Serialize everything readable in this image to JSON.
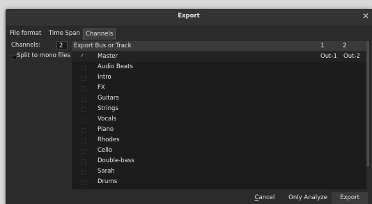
{
  "window": {
    "title": "Export"
  },
  "tabs": [
    "File format",
    "Time Span",
    "Channels"
  ],
  "channels": {
    "label": "Channels:",
    "value": "2"
  },
  "split_mono": {
    "label": "Split to mono files",
    "checked": false
  },
  "table": {
    "headers": [
      "Export Bus or Track",
      "1",
      "2"
    ],
    "rows": [
      {
        "name": "Master",
        "checked": true,
        "out1": "Out-1",
        "out2": "Out-2"
      },
      {
        "name": "Audio Beats",
        "checked": false,
        "out1": "",
        "out2": ""
      },
      {
        "name": "Intro",
        "checked": false,
        "out1": "",
        "out2": ""
      },
      {
        "name": "FX",
        "checked": false,
        "out1": "",
        "out2": ""
      },
      {
        "name": "Guitars",
        "checked": false,
        "out1": "",
        "out2": ""
      },
      {
        "name": "Strings",
        "checked": false,
        "out1": "",
        "out2": ""
      },
      {
        "name": "Vocals",
        "checked": false,
        "out1": "",
        "out2": ""
      },
      {
        "name": "Piano",
        "checked": false,
        "out1": "",
        "out2": ""
      },
      {
        "name": "Rhodes",
        "checked": false,
        "out1": "",
        "out2": ""
      },
      {
        "name": "Cello",
        "checked": false,
        "out1": "",
        "out2": ""
      },
      {
        "name": "Double-bass",
        "checked": false,
        "out1": "",
        "out2": ""
      },
      {
        "name": "Sarah",
        "checked": false,
        "out1": "",
        "out2": ""
      },
      {
        "name": "Drums",
        "checked": false,
        "out1": "",
        "out2": ""
      }
    ]
  },
  "buttons": {
    "cancel": "Cancel",
    "analyze": "Only Analyze",
    "export": "Export"
  }
}
